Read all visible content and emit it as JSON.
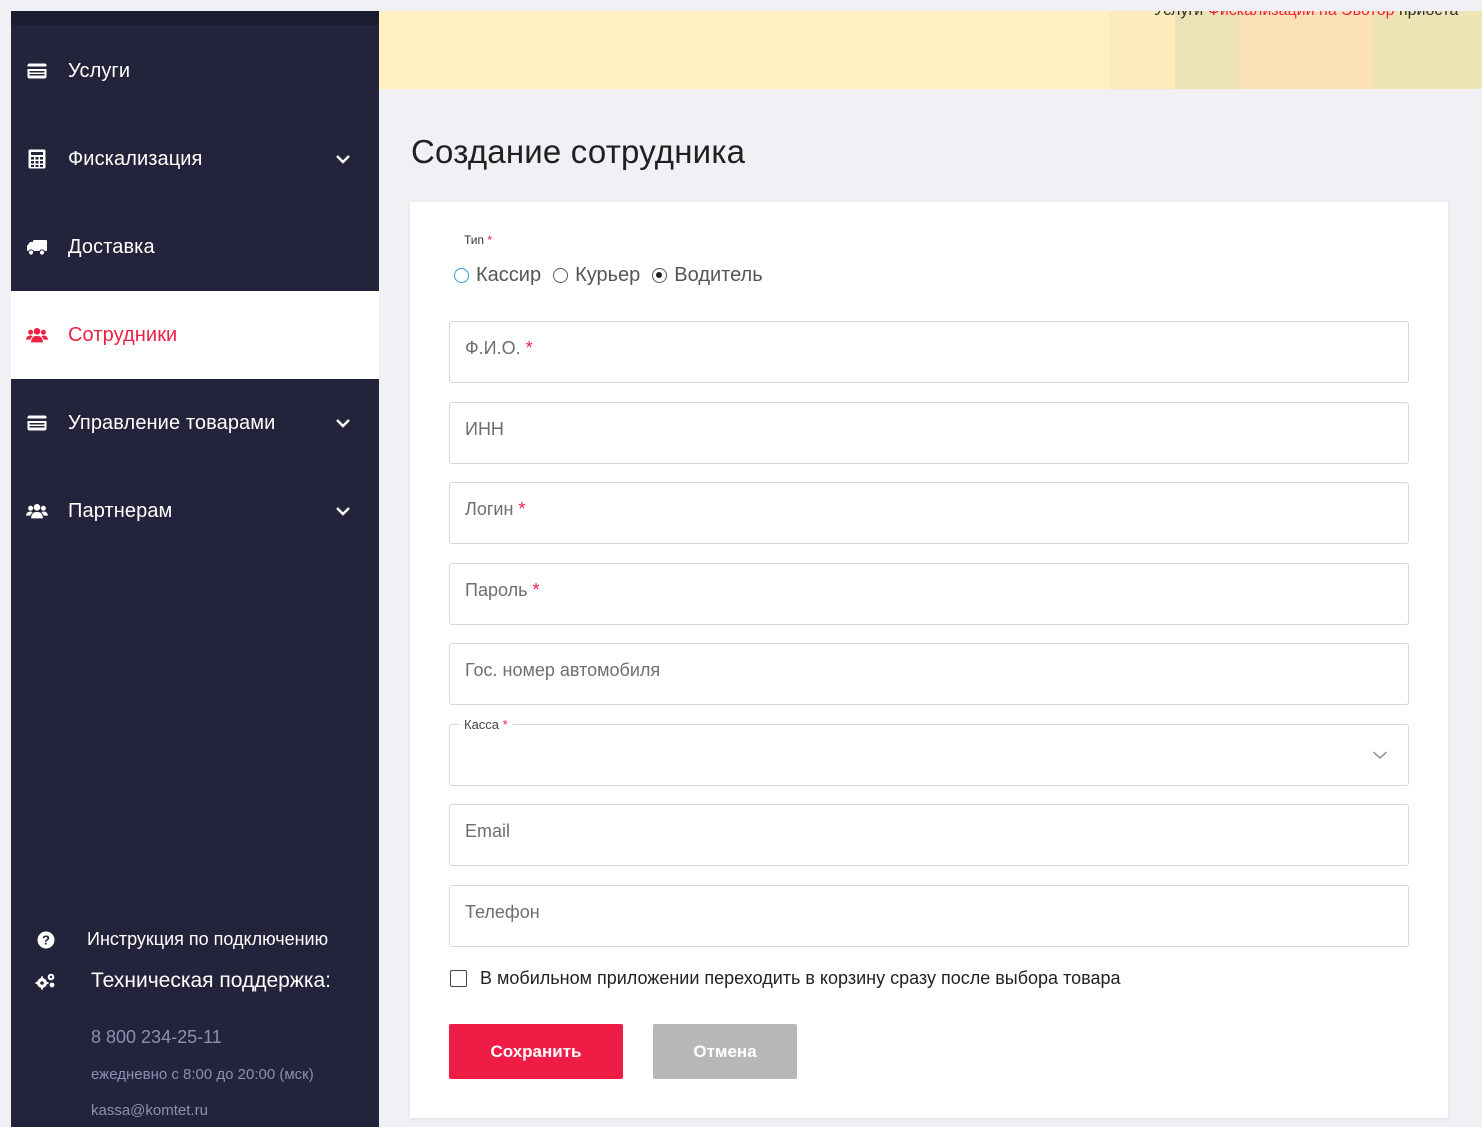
{
  "sidebar": {
    "items": [
      {
        "label": "Услуги",
        "icon": "credit-card-icon"
      },
      {
        "label": "Фискализация",
        "icon": "calculator-icon"
      },
      {
        "label": "Доставка",
        "icon": "truck-icon"
      },
      {
        "label": "Сотрудники",
        "icon": "users-icon"
      },
      {
        "label": "Управление товарами",
        "icon": "credit-card-icon"
      },
      {
        "label": "Партнерам",
        "icon": "users-icon"
      }
    ],
    "help_link": "Инструкция по подключению",
    "support_title": "Техническая поддержка:",
    "support_phone": "8 800 234-25-11",
    "support_hours": "ежедневно с 8:00 до 20:00 (мск)",
    "support_email": "kassa@komtet.ru"
  },
  "banner": {
    "text_prefix": "Услуги ",
    "text_link": "Фискализации на Эвотор",
    "text_suffix": " приоста"
  },
  "page": {
    "title": "Создание сотрудника"
  },
  "form": {
    "type_label": "Тип",
    "required_mark": "*",
    "type_options": [
      "Кассир",
      "Курьер",
      "Водитель"
    ],
    "selected_type": "Водитель",
    "fields": {
      "fio": "Ф.И.О.",
      "inn": "ИНН",
      "login": "Логин",
      "password": "Пароль",
      "car_number": "Гос. номер автомобиля",
      "kassa": "Касса",
      "email": "Email",
      "phone": "Телефон"
    },
    "checkbox_label": "В мобильном приложении переходить в корзину сразу после выбора товара",
    "save_label": "Сохранить",
    "cancel_label": "Отмена"
  },
  "colors": {
    "accent": "#ee2147",
    "sidebar_bg": "#23233b",
    "banner_bg": "#fff2c0"
  }
}
